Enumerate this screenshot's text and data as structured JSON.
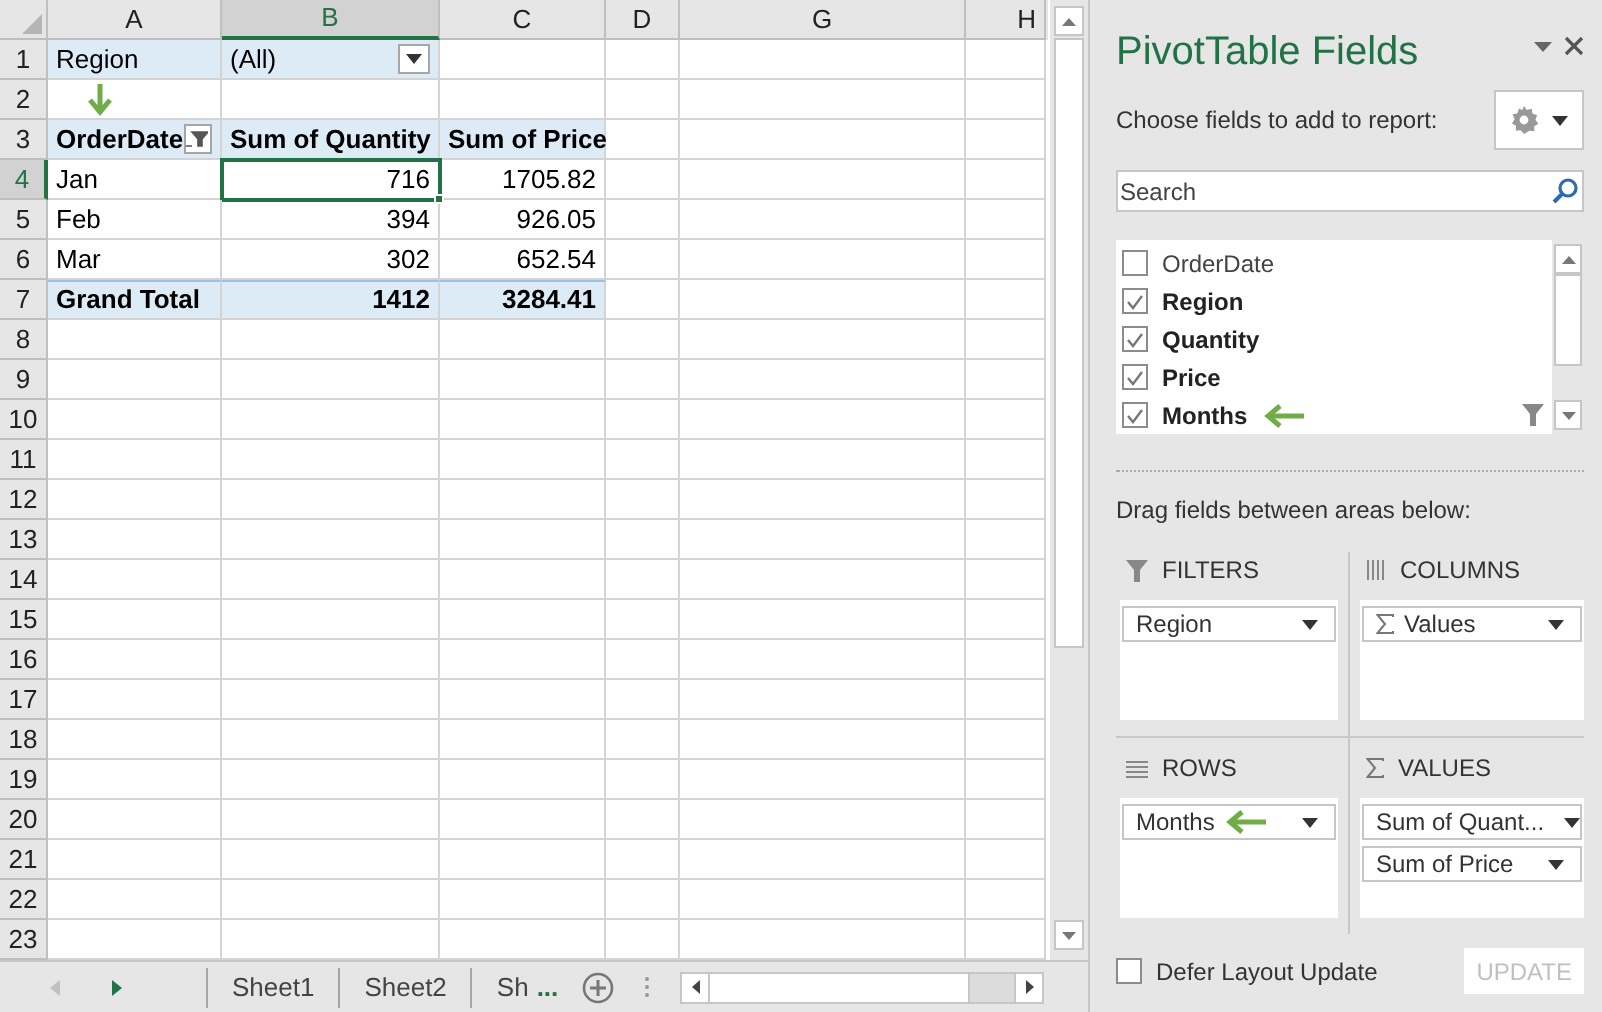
{
  "sheet": {
    "columns": [
      {
        "label": "A",
        "selected": false
      },
      {
        "label": "B",
        "selected": true
      },
      {
        "label": "C",
        "selected": false
      },
      {
        "label": "D",
        "selected": false
      },
      {
        "label": "G",
        "selected": false
      },
      {
        "label": "H",
        "selected": false
      }
    ],
    "rows": [
      {
        "number": "1",
        "selected": false,
        "cells": [
          {
            "kind": "filter-label",
            "text": "Region"
          },
          {
            "kind": "filter-value",
            "text": "(All)"
          }
        ]
      },
      {
        "number": "2",
        "selected": false,
        "cells": [
          {
            "kind": "arrow"
          }
        ]
      },
      {
        "number": "3",
        "selected": false,
        "cells": [
          {
            "kind": "row-header",
            "text": "OrderDate"
          },
          {
            "kind": "col-header",
            "text": "Sum of Quantity"
          },
          {
            "kind": "col-header",
            "text": "Sum of Price"
          }
        ]
      },
      {
        "number": "4",
        "selected": true,
        "cells": [
          {
            "kind": "label",
            "text": "Jan"
          },
          {
            "kind": "value",
            "text": "716",
            "selected": true
          },
          {
            "kind": "value",
            "text": "1705.82",
            "selected": false
          }
        ]
      },
      {
        "number": "5",
        "selected": false,
        "cells": [
          {
            "kind": "label",
            "text": "Feb"
          },
          {
            "kind": "value",
            "text": "394",
            "selected": false
          },
          {
            "kind": "value",
            "text": "926.05",
            "selected": false
          }
        ]
      },
      {
        "number": "6",
        "selected": false,
        "cells": [
          {
            "kind": "label",
            "text": "Mar"
          },
          {
            "kind": "value",
            "text": "302",
            "selected": false
          },
          {
            "kind": "value",
            "text": "652.54",
            "selected": false
          }
        ]
      },
      {
        "number": "7",
        "selected": false,
        "cells": [
          {
            "kind": "total-label",
            "text": "Grand Total"
          },
          {
            "kind": "total-value",
            "text": "1412"
          },
          {
            "kind": "total-value",
            "text": "3284.41"
          }
        ]
      },
      {
        "number": "8",
        "selected": false,
        "cells": []
      },
      {
        "number": "9",
        "selected": false,
        "cells": []
      },
      {
        "number": "10",
        "selected": false,
        "cells": []
      },
      {
        "number": "11",
        "selected": false,
        "cells": []
      },
      {
        "number": "12",
        "selected": false,
        "cells": []
      },
      {
        "number": "13",
        "selected": false,
        "cells": []
      },
      {
        "number": "14",
        "selected": false,
        "cells": []
      },
      {
        "number": "15",
        "selected": false,
        "cells": []
      },
      {
        "number": "16",
        "selected": false,
        "cells": []
      },
      {
        "number": "17",
        "selected": false,
        "cells": []
      },
      {
        "number": "18",
        "selected": false,
        "cells": []
      },
      {
        "number": "19",
        "selected": false,
        "cells": []
      },
      {
        "number": "20",
        "selected": false,
        "cells": []
      },
      {
        "number": "21",
        "selected": false,
        "cells": []
      },
      {
        "number": "22",
        "selected": false,
        "cells": []
      },
      {
        "number": "23",
        "selected": false,
        "cells": []
      }
    ]
  },
  "sheet_tabs": [
    {
      "label": "Sheet1",
      "selected": false
    },
    {
      "label": "Sheet2",
      "selected": false
    },
    {
      "label": "Sh",
      "selected": false
    }
  ],
  "more_tabs": "...",
  "panel": {
    "title": "PivotTable Fields",
    "prompt": "Choose fields to add to report:",
    "search": {
      "placeholder": "Search"
    },
    "fields": [
      {
        "label": "OrderDate",
        "checked": false,
        "filtered": false,
        "arrow": false
      },
      {
        "label": "Region",
        "checked": true,
        "filtered": false,
        "arrow": false
      },
      {
        "label": "Quantity",
        "checked": true,
        "filtered": false,
        "arrow": false
      },
      {
        "label": "Price",
        "checked": true,
        "filtered": false,
        "arrow": false
      },
      {
        "label": "Months",
        "checked": true,
        "filtered": true,
        "arrow": true
      }
    ],
    "areas_hint": "Drag fields between areas below:",
    "areas": [
      {
        "kind": "filters",
        "title": "FILTERS",
        "items": [
          {
            "label": "Region",
            "sigma": false,
            "arrow": false
          }
        ]
      },
      {
        "kind": "columns",
        "title": "COLUMNS",
        "items": [
          {
            "label": "Values",
            "sigma": true,
            "arrow": false
          }
        ]
      },
      {
        "kind": "rows",
        "title": "ROWS",
        "items": [
          {
            "label": "Months",
            "sigma": false,
            "arrow": true
          }
        ]
      },
      {
        "kind": "values",
        "title": "VALUES",
        "items": [
          {
            "label": "Sum of Quant...",
            "sigma": false,
            "arrow": false
          },
          {
            "label": "Sum of Price",
            "sigma": false,
            "arrow": false
          }
        ]
      }
    ],
    "defer": {
      "label": "Defer Layout Update",
      "checked": false
    },
    "update": {
      "label": "UPDATE",
      "disabled": true
    }
  }
}
